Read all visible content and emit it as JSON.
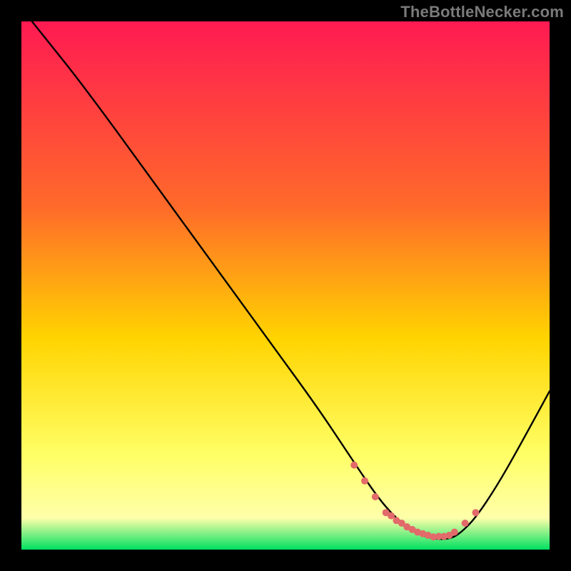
{
  "attribution": "TheBottleNecker.com",
  "chart_data": {
    "type": "line",
    "title": "",
    "xlabel": "",
    "ylabel": "",
    "xlim": [
      0,
      100
    ],
    "ylim": [
      0,
      100
    ],
    "gradient_stops": [
      {
        "offset": 0,
        "color": "#ff1a52"
      },
      {
        "offset": 35,
        "color": "#ff6a2a"
      },
      {
        "offset": 60,
        "color": "#ffd400"
      },
      {
        "offset": 82,
        "color": "#ffff66"
      },
      {
        "offset": 94,
        "color": "#ffffaa"
      },
      {
        "offset": 100,
        "color": "#00e060"
      }
    ],
    "series": [
      {
        "name": "bottleneck-curve",
        "color": "#000000",
        "width": 2.4,
        "x": [
          2,
          6,
          10,
          16,
          24,
          32,
          40,
          48,
          56,
          62,
          66,
          69,
          72,
          75,
          78,
          81,
          83,
          86,
          90,
          94,
          100
        ],
        "y": [
          100,
          95,
          90,
          82,
          71,
          60,
          49,
          38,
          27,
          18,
          12,
          8,
          5,
          3,
          2,
          2,
          3,
          6,
          12,
          19,
          30
        ]
      }
    ],
    "markers": {
      "name": "recommended-range",
      "color": "#e26a6a",
      "radius": 5,
      "x": [
        63,
        65,
        67,
        69,
        70,
        71,
        72,
        73,
        74,
        75,
        76,
        77,
        78,
        79,
        80,
        81,
        82,
        84,
        86
      ],
      "y": [
        16,
        13,
        10,
        7,
        6.4,
        5.5,
        5,
        4.3,
        3.8,
        3.3,
        3.0,
        2.7,
        2.4,
        2.5,
        2.5,
        2.7,
        3.3,
        5,
        7
      ]
    }
  }
}
